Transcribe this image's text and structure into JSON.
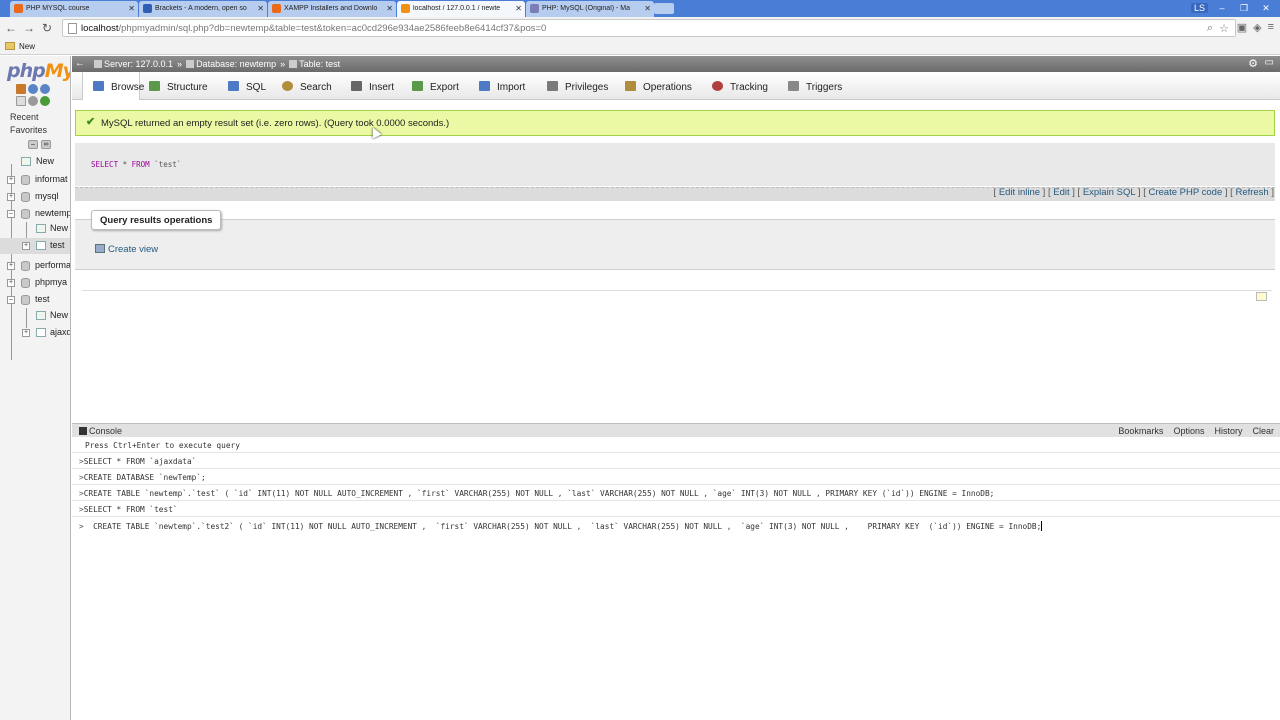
{
  "browser": {
    "tabs": [
      {
        "title": "PHP MYSQL course",
        "color": "#ea6a1a"
      },
      {
        "title": "Brackets - A modern, open so",
        "color": "#2f5fb5"
      },
      {
        "title": "XAMPP Installers and Downlo",
        "color": "#ea6a1a"
      },
      {
        "title": "localhost / 127.0.0.1 / newte",
        "color": "#f29111"
      },
      {
        "title": "PHP: MySQL (Original) - Ma",
        "color": "#7b7fb5"
      }
    ],
    "profile": "LS",
    "url_host": "localhost",
    "url_path": "/phpmyadmin/sql.php?db=newtemp&table=test&token=ac0cd296e934ae2586feeb8e6414cf37&pos=0",
    "bookmark_folder": "New"
  },
  "nav": {
    "logo_php": "php",
    "logo_my": "My",
    "recent": "Recent",
    "favorites": "Favorites",
    "tree": [
      {
        "label": "New"
      },
      {
        "label": "informat"
      },
      {
        "label": "mysql"
      },
      {
        "label": "newtemp"
      },
      {
        "label": "New"
      },
      {
        "label": "test"
      },
      {
        "label": "performa"
      },
      {
        "label": "phpmya"
      },
      {
        "label": "test"
      },
      {
        "label": "New"
      },
      {
        "label": "ajaxd"
      }
    ]
  },
  "breadcrumb": {
    "server": "Server: 127.0.0.1",
    "database": "Database: newtemp",
    "table": "Table: test"
  },
  "menu": {
    "tabs": [
      {
        "label": "Browse",
        "color": "#4e79c4"
      },
      {
        "label": "Structure",
        "color": "#5a9a4a"
      },
      {
        "label": "SQL",
        "color": "#4e79c4"
      },
      {
        "label": "Search",
        "color": "#b08c3c"
      },
      {
        "label": "Insert",
        "color": "#666666"
      },
      {
        "label": "Export",
        "color": "#5a9a4a"
      },
      {
        "label": "Import",
        "color": "#4e79c4"
      },
      {
        "label": "Privileges",
        "color": "#7a7a7a"
      },
      {
        "label": "Operations",
        "color": "#b08c3c"
      },
      {
        "label": "Tracking",
        "color": "#b04040"
      },
      {
        "label": "Triggers",
        "color": "#888888"
      }
    ]
  },
  "result": {
    "message": "MySQL returned an empty result set (i.e. zero rows). (Query took 0.0000 seconds.)",
    "sql_select": "SELECT",
    "sql_star": "*",
    "sql_from": "FROM",
    "sql_table": "`test`"
  },
  "query_links": {
    "edit_inline": "Edit inline",
    "edit": "Edit",
    "explain": "Explain SQL",
    "create_php": "Create PHP code",
    "refresh": "Refresh"
  },
  "operations": {
    "legend": "Query results operations",
    "create_view": "Create view"
  },
  "console": {
    "title": "Console",
    "options": [
      "Bookmarks",
      "Options",
      "History",
      "Clear"
    ],
    "hint": "Press Ctrl+Enter to execute query",
    "line1": "SELECT * FROM `ajaxdata`",
    "line2": "CREATE DATABASE `newTemp`;",
    "line3": "CREATE TABLE `newtemp`.`test` ( `id` INT(11) NOT NULL AUTO_INCREMENT , `first` VARCHAR(255) NOT NULL , `last` VARCHAR(255) NOT NULL , `age` INT(3) NOT NULL , PRIMARY KEY (`id`)) ENGINE = InnoDB;",
    "line4": "SELECT * FROM `test`",
    "line5": "  CREATE TABLE `newtemp`.`test2` ( `id` INT(11) NOT NULL AUTO_INCREMENT ,  `first` VARCHAR(255) NOT NULL ,  `last` VARCHAR(255) NOT NULL ,  `age` INT(3) NOT NULL ,    PRIMARY KEY  (`id`)) ENGINE = InnoDB;"
  }
}
